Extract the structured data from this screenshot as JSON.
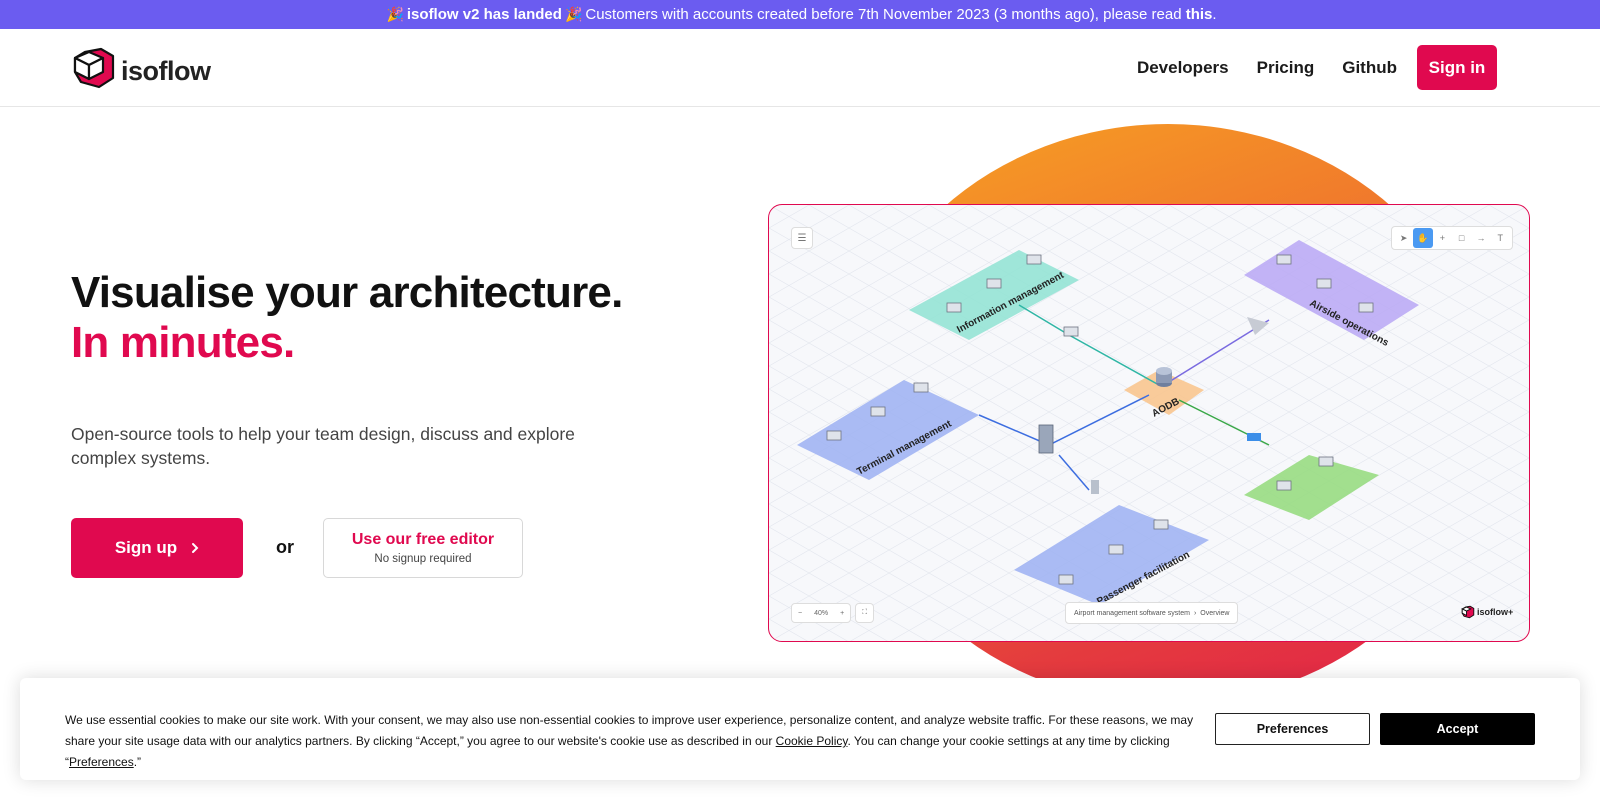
{
  "banner": {
    "emoji": "🎉",
    "headline": "isoflow v2 has landed",
    "message": "Customers with accounts created before 7th November 2023 (3 months ago), please read",
    "link": "this",
    "suffix": "."
  },
  "header": {
    "logo_text": "isoflow",
    "nav": [
      "Developers",
      "Pricing",
      "Github"
    ],
    "signin_label": "Sign in"
  },
  "hero": {
    "title": "Visualise your architecture.",
    "title_accent": "In minutes.",
    "subtitle": "Open-source tools to help your team design, discuss and explore complex systems.",
    "signup_label": "Sign up",
    "or_label": "or",
    "editor_label": "Use our free editor",
    "editor_sub": "No signup required"
  },
  "preview": {
    "zoom_level": "40%",
    "breadcrumb_root": "Airport management software system",
    "breadcrumb_page": "Overview",
    "brand": "isoflow+",
    "zones": [
      {
        "label": "Information management",
        "color": "#8fe3d2"
      },
      {
        "label": "Airside operations",
        "color": "#b9a7f5"
      },
      {
        "label": "Terminal management",
        "color": "#9cb0f2"
      },
      {
        "label": "AODB",
        "color": "#f8c58f"
      },
      {
        "label": "Passenger facilitation",
        "color": "#9cb0f2"
      },
      {
        "label": "",
        "color": "#98dc82"
      }
    ]
  },
  "cookie": {
    "text_before": "We use essential cookies to make our site work. With your consent, we may also use non-essential cookies to improve user experience, personalize content, and analyze website traffic. For these reasons, we may share your site usage data with our analytics partners. By clicking “Accept,” you agree to our website's cookie use as described in our ",
    "policy_link": "Cookie Policy",
    "text_middle": ". You can change your cookie settings at any time by clicking “",
    "prefs_link": "Preferences",
    "text_end": ".”",
    "preferences_label": "Preferences",
    "accept_label": "Accept"
  },
  "colors": {
    "brand": "#e0094f",
    "banner": "#6b5cf0"
  }
}
